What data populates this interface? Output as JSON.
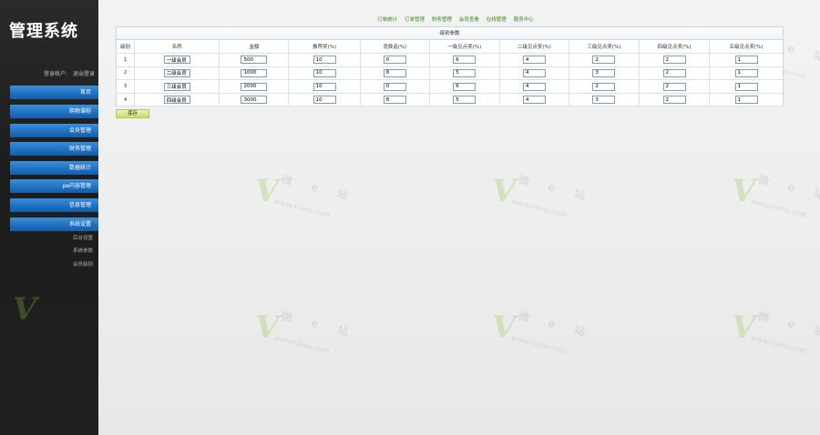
{
  "app": {
    "title": "管理系统"
  },
  "login": {
    "user_label": "登录帐户:",
    "logout_label": "退出登录"
  },
  "sidebar": {
    "items": [
      {
        "label": "首页"
      },
      {
        "label": "购物课程"
      },
      {
        "label": "会员管理"
      },
      {
        "label": "财务管理"
      },
      {
        "label": "数据统计"
      },
      {
        "label": "pe内容管理"
      },
      {
        "label": "信息管理"
      },
      {
        "label": "系统设置"
      }
    ],
    "sub_items": [
      {
        "label": "后台设置"
      },
      {
        "label": "系统参数"
      },
      {
        "label": "会员级别"
      }
    ]
  },
  "top_nav": {
    "links": [
      {
        "label": "订单统计"
      },
      {
        "label": "订单管理"
      },
      {
        "label": "财务管理"
      },
      {
        "label": "会员查看"
      },
      {
        "label": "在线管理"
      },
      {
        "label": "服务中心"
      }
    ]
  },
  "panel": {
    "title": "级别参数",
    "columns": [
      "级别",
      "名称",
      "金额",
      "推荐奖(%)",
      "消费返(%)",
      "一级见点奖(%)",
      "二级见点奖(%)",
      "三级见点奖(%)",
      "四级见点奖(%)",
      "五级见点奖(%)"
    ],
    "rows": [
      {
        "level": "1",
        "name": "一级会员",
        "amount": "500",
        "referral": "10",
        "consume": "0",
        "l1": "6",
        "l2": "4",
        "l3": "2",
        "l4": "2",
        "l5": "1"
      },
      {
        "level": "2",
        "name": "二级会员",
        "amount": "1000",
        "referral": "10",
        "consume": "8",
        "l1": "5",
        "l2": "4",
        "l3": "3",
        "l4": "2",
        "l5": "1"
      },
      {
        "level": "3",
        "name": "三级会员",
        "amount": "2000",
        "referral": "10",
        "consume": "0",
        "l1": "6",
        "l2": "4",
        "l3": "2",
        "l4": "2",
        "l5": "1"
      },
      {
        "level": "4",
        "name": "四级会员",
        "amount": "3000",
        "referral": "10",
        "consume": "8",
        "l1": "5",
        "l2": "4",
        "l3": "3",
        "l4": "2",
        "l5": "1"
      }
    ],
    "save_label": "保存"
  },
  "watermark": {
    "brand": "微 e 站",
    "url": "www.vioee.com"
  },
  "colors": {
    "nav_blue": "#1d6fc0",
    "link_green": "#3a8a18",
    "save_green": "#c9dc6a",
    "sidebar_bg": "#1d1d1d"
  }
}
